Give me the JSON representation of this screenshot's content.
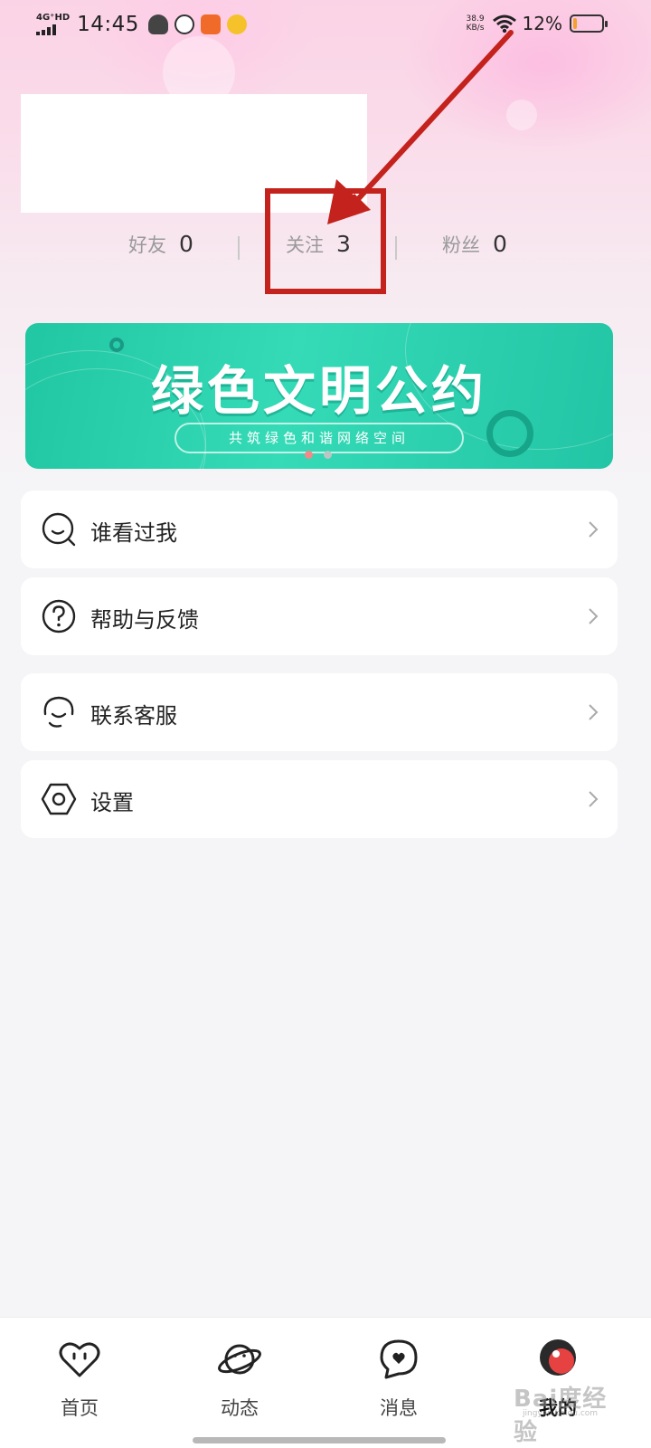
{
  "status_bar": {
    "network": "4G⁺HD",
    "time": "14:45",
    "speed_value": "38.9",
    "speed_unit": "KB/s",
    "battery_percent": "12%",
    "battery_level": 0.12
  },
  "stats": {
    "friends": {
      "label": "好友",
      "value": "0"
    },
    "following": {
      "label": "关注",
      "value": "3"
    },
    "fans": {
      "label": "粉丝",
      "value": "0"
    }
  },
  "banner": {
    "title": "绿色文明公约",
    "subtitle": "共筑绿色和谐网络空间",
    "page_count": 2,
    "active_page": 1
  },
  "menu": [
    {
      "label": "谁看过我",
      "icon": "visitors-icon"
    },
    {
      "label": "帮助与反馈",
      "icon": "help-icon"
    },
    {
      "label": "联系客服",
      "icon": "customer-service-icon"
    },
    {
      "label": "设置",
      "icon": "settings-icon"
    }
  ],
  "tabbar": {
    "tabs": [
      {
        "label": "首页",
        "icon": "heart-icon"
      },
      {
        "label": "动态",
        "icon": "planet-icon"
      },
      {
        "label": "消息",
        "icon": "message-icon"
      },
      {
        "label": "我的",
        "icon": "avatar-icon",
        "active": true
      }
    ]
  },
  "watermark": {
    "text": "Bai度经验",
    "url": "jingyan.baidu.com"
  },
  "colors": {
    "accent_red": "#c4221c",
    "banner_green": "#2fd3b0",
    "battery_orange": "#f4a12b"
  }
}
